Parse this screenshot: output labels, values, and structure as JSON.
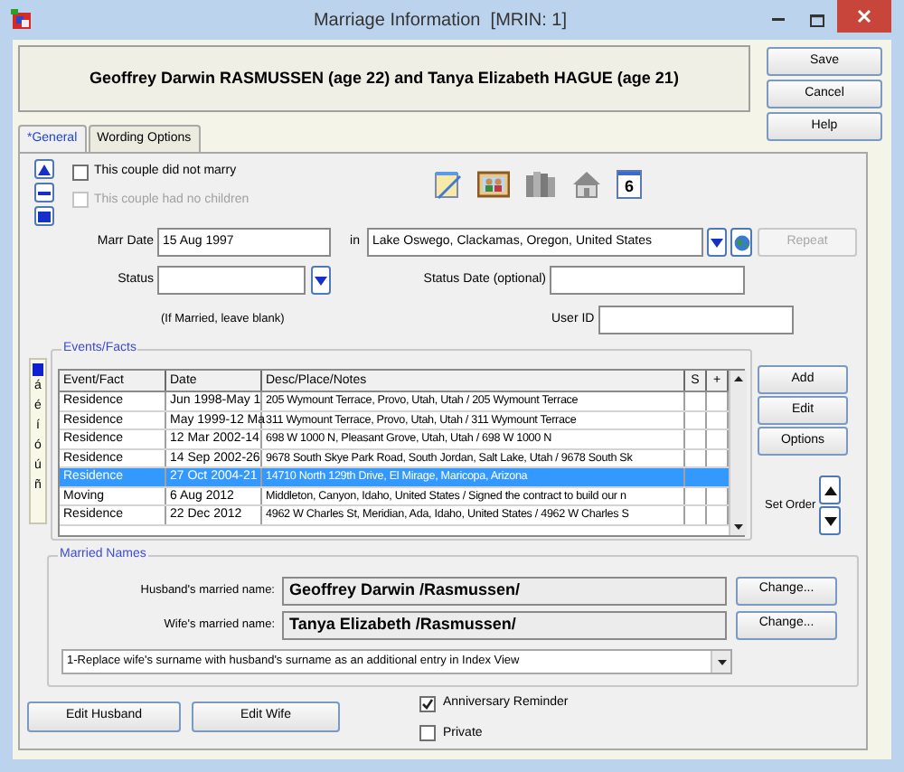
{
  "window": {
    "title": "Marriage Information  [MRIN: 1]"
  },
  "header": {
    "couple": "Geoffrey Darwin RASMUSSEN (age 22) and Tanya Elizabeth HAGUE (age 21)"
  },
  "dialog_buttons": [
    "Save",
    "Cancel",
    "Help"
  ],
  "tabs": [
    {
      "label": "*General",
      "selected": true
    },
    {
      "label": "Wording Options",
      "selected": false
    }
  ],
  "options": [
    {
      "label": "This couple did not marry",
      "checked": false,
      "disabled": false
    },
    {
      "label": "This couple had no children",
      "checked": false,
      "disabled": true
    }
  ],
  "calendar_day": "6",
  "marr_date": {
    "label": "Marr Date",
    "value": "15 Aug 1997"
  },
  "place": {
    "label": "in",
    "value": "Lake Oswego, Clackamas, Oregon, United States"
  },
  "repeat_button": {
    "label": "Repeat",
    "disabled": true
  },
  "status": {
    "label": "Status",
    "hint": "(If Married, leave blank)"
  },
  "status_date": {
    "label": "Status Date (optional)"
  },
  "user_id": {
    "label": "User ID"
  },
  "events": {
    "title": "Events/Facts",
    "accent_chars": [
      "á",
      "é",
      "í",
      "ó",
      "ú",
      "ñ"
    ],
    "columns": [
      "Event/Fact",
      "Date",
      "Desc/Place/Notes",
      "S",
      "+"
    ],
    "rows": [
      {
        "cells": [
          "Residence",
          "Jun 1998-May 1",
          "205 Wymount Terrace, Provo, Utah, Utah / 205 Wymount Terrace"
        ],
        "selected": false
      },
      {
        "cells": [
          "Residence",
          "May 1999-12 Ma",
          "311 Wymount Terrace, Provo, Utah, Utah / 311 Wymount Terrace"
        ],
        "selected": false
      },
      {
        "cells": [
          "Residence",
          "12 Mar 2002-14",
          "698 W 1000 N, Pleasant Grove, Utah, Utah / 698 W 1000 N"
        ],
        "selected": false
      },
      {
        "cells": [
          "Residence",
          "14 Sep 2002-26",
          "9678 South Skye Park Road, South Jordan, Salt Lake, Utah / 9678 South Sk"
        ],
        "selected": false
      },
      {
        "cells": [
          "Residence",
          "27 Oct 2004-21",
          "14710 North 129th Drive, El Mirage, Maricopa, Arizona"
        ],
        "selected": true
      },
      {
        "cells": [
          "Moving",
          "6 Aug 2012",
          "Middleton, Canyon, Idaho, United States / Signed the contract to build our n"
        ],
        "selected": false
      },
      {
        "cells": [
          "Residence",
          "22 Dec 2012",
          "4962 W Charles St, Meridian, Ada, Idaho, United States / 4962 W Charles S"
        ],
        "selected": false
      }
    ],
    "buttons": [
      "Add",
      "Edit",
      "Options"
    ],
    "set_order": "Set Order"
  },
  "married_names": {
    "title": "Married Names",
    "husband": {
      "label": "Husband's married name:",
      "value": "Geoffrey Darwin /Rasmussen/",
      "button": "Change..."
    },
    "wife": {
      "label": "Wife's married name:",
      "value": "Tanya Elizabeth /Rasmussen/",
      "button": "Change..."
    },
    "index_option": "1-Replace wife's surname with husband's surname as an additional entry in Index View"
  },
  "reminders": [
    {
      "label": "Anniversary Reminder",
      "checked": true
    },
    {
      "label": "Private",
      "checked": false
    }
  ],
  "edit_buttons": [
    "Edit Husband",
    "Edit Wife"
  ]
}
